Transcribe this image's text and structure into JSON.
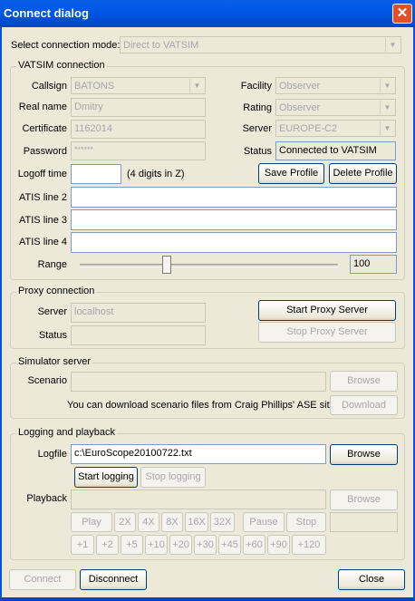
{
  "window": {
    "title": "Connect dialog"
  },
  "mode": {
    "label": "Select connection mode:",
    "value": "Direct to VATSIM"
  },
  "vatsim": {
    "group_title": "VATSIM connection",
    "callsign_label": "Callsign",
    "callsign_value": "BATONS",
    "realname_label": "Real name",
    "realname_value": "Dmitry",
    "certificate_label": "Certificate",
    "certificate_value": "1162014",
    "password_label": "Password",
    "password_value": "******",
    "logoff_label": "Logoff time",
    "logoff_value": "",
    "logoff_hint": "(4 digits in Z)",
    "facility_label": "Facility",
    "facility_value": "Observer",
    "rating_label": "Rating",
    "rating_value": "Observer",
    "server_label": "Server",
    "server_value": "EUROPE-C2",
    "status_label": "Status",
    "status_value": "Connected to VATSIM",
    "save_profile": "Save Profile",
    "delete_profile": "Delete Profile",
    "atis2_label": "ATIS line 2",
    "atis2_value": "",
    "atis3_label": "ATIS line 3",
    "atis3_value": "",
    "atis4_label": "ATIS line 4",
    "atis4_value": "",
    "range_label": "Range",
    "range_value": "100",
    "range_fraction": 0.33
  },
  "proxy": {
    "group_title": "Proxy connection",
    "server_label": "Server",
    "server_value": "localhost",
    "status_label": "Status",
    "status_value": "",
    "start_button": "Start Proxy Server",
    "stop_button": "Stop Proxy Server"
  },
  "simulator": {
    "group_title": "Simulator server",
    "scenario_label": "Scenario",
    "scenario_value": "",
    "browse_button": "Browse",
    "download_hint": "You can download scenario files from Craig Phillips' ASE site",
    "download_button": "Download"
  },
  "logging": {
    "group_title": "Logging and playback",
    "logfile_label": "Logfile",
    "logfile_value": "c:\\EuroScope20100722.txt",
    "browse_button": "Browse",
    "start_logging": "Start logging",
    "stop_logging": "Stop logging",
    "playback_label": "Playback",
    "playback_value": "",
    "playback_browse": "Browse",
    "controls": {
      "play": "Play",
      "x2": "2X",
      "x4": "4X",
      "x8": "8X",
      "x16": "16X",
      "x32": "32X",
      "pause": "Pause",
      "stop": "Stop"
    },
    "jumps": [
      "+1",
      "+2",
      "+5",
      "+10",
      "+20",
      "+30",
      "+45",
      "+60",
      "+90",
      "+120"
    ]
  },
  "footer": {
    "connect": "Connect",
    "disconnect": "Disconnect",
    "close": "Close"
  }
}
